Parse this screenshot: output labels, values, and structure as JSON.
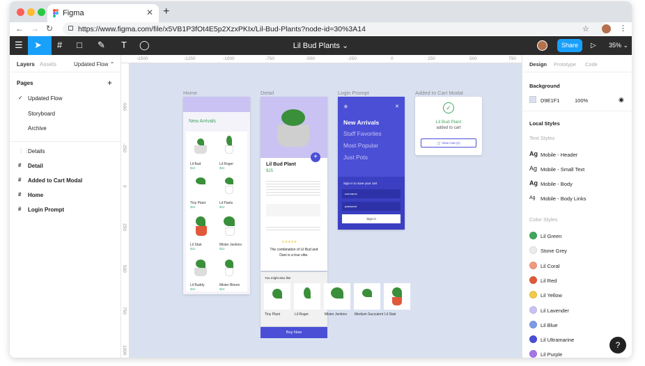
{
  "browser": {
    "tab_title": "Figma",
    "url": "https://www.figma.com/file/x5VB1P3fOt4E5p2XzxPKIx/Lil-Bud-Plants?node-id=30%3A14",
    "new_tab": "+",
    "close_tab": "✕"
  },
  "toolbar": {
    "doc_title": "Lil Bud Plants ⌄",
    "share_label": "Share",
    "zoom": "35% ⌄"
  },
  "left_panel": {
    "tabs": [
      "Layers",
      "Assets"
    ],
    "page_selector": "Updated Flow ⌃",
    "pages_header": "Pages",
    "pages": [
      "Updated Flow",
      "Storyboard",
      "Archive"
    ],
    "layers": [
      "Details",
      "Detail",
      "Added to Cart Modal",
      "Home",
      "Login Prompt"
    ]
  },
  "right_panel": {
    "tabs": [
      "Design",
      "Prototype",
      "Code"
    ],
    "background_header": "Background",
    "bg_hex": "D9E1F1",
    "bg_opacity": "100%",
    "local_styles_header": "Local Styles",
    "text_styles_header": "Text Styles",
    "text_styles": [
      "Mobile - Header",
      "Mobile - Small Text",
      "Mobile - Body",
      "Mobile - Body Links"
    ],
    "color_styles_header": "Color Styles",
    "color_styles": [
      {
        "name": "Lil Green",
        "color": "#3fa65e"
      },
      {
        "name": "Stone Grey",
        "color": "#ececec"
      },
      {
        "name": "Lil Coral",
        "color": "#f09a80"
      },
      {
        "name": "Lil Red",
        "color": "#e0593b"
      },
      {
        "name": "Lil Yellow",
        "color": "#f3c94a"
      },
      {
        "name": "Lil Lavender",
        "color": "#c9c2f2"
      },
      {
        "name": "Lil Blue",
        "color": "#7d9ae6"
      },
      {
        "name": "Lil Ultramarine",
        "color": "#4a4fd6"
      },
      {
        "name": "Lil Purple",
        "color": "#a776e6"
      }
    ]
  },
  "canvas": {
    "ruler_top": [
      "-1500",
      "-1250",
      "-1000",
      "-750",
      "-500",
      "-250",
      "0",
      "250",
      "500",
      "750"
    ],
    "ruler_left": [
      "-500",
      "-250",
      "0",
      "250",
      "500",
      "750",
      "1000"
    ],
    "frames": {
      "home": "Home",
      "detail": "Detail",
      "login": "Login Prompt",
      "modal": "Added to Cart Modal"
    },
    "home": {
      "heading": "New Arrivals",
      "products": [
        "Lil Bud",
        "Lil Roger",
        "Tiny Plant",
        "Lil Pants",
        "Lil Stair",
        "Mister Jenkins",
        "Lil Buddy",
        "Mister Bloom"
      ],
      "price": "$22"
    },
    "detail": {
      "title": "Lil Bud Plant",
      "price": "$25",
      "quote": "The combination of Lil Bud and Dani is a true vibe.",
      "might_like": "You might also like",
      "related": [
        "Tiny Plant",
        "Lil Roger",
        "Mister Jenkins",
        "Medium Succulent",
        "Lil Stair"
      ],
      "buy": "Buy Now"
    },
    "login": {
      "menu": [
        "New Arrivals",
        "Staff Favorites",
        "Most Popular",
        "Just Pots"
      ],
      "sign_in_prompt": "Sign in to save your cart",
      "username": "username",
      "password": "password",
      "button": "Sign in"
    },
    "modal": {
      "line1": "Lil Bud Plant",
      "line2": "added to cart",
      "button": "🛒 View Cart (1)"
    }
  }
}
